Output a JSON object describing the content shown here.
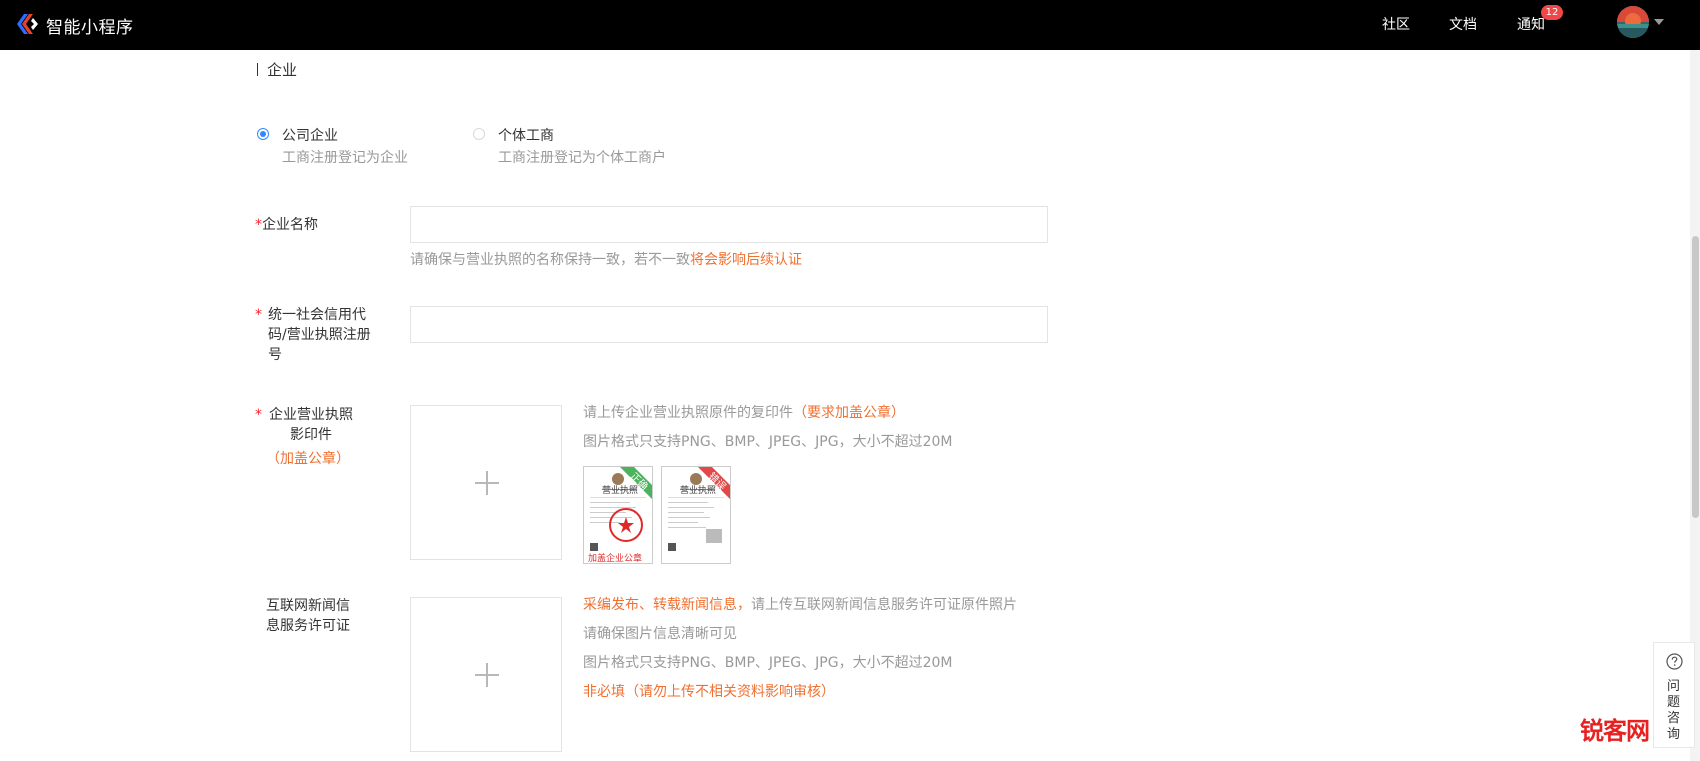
{
  "header": {
    "brand": "智能小程序",
    "nav": [
      {
        "label": "社区"
      },
      {
        "label": "文档"
      },
      {
        "label": "通知",
        "badge": "12"
      }
    ]
  },
  "section": {
    "title": "企业"
  },
  "entity_type": {
    "options": [
      {
        "title": "公司企业",
        "desc": "工商注册登记为企业",
        "selected": true
      },
      {
        "title": "个体工商",
        "desc": "工商注册登记为个体工商户",
        "selected": false
      }
    ]
  },
  "fields": {
    "company_name": {
      "required_mark": "*",
      "label": "企业名称",
      "value": "",
      "hint": "请确保与营业执照的名称保持一致，若不一致",
      "hint_warning": "将会影响后续认证"
    },
    "credit_code": {
      "required_mark": "*",
      "label_lines": [
        "统一社会信用代",
        "码/营业执照注册",
        "号"
      ],
      "value": ""
    },
    "license_copy": {
      "required_mark": "*",
      "label_lines": [
        "企业营业执照",
        "影印件"
      ],
      "label_note": "（加盖公章）",
      "hint": "请上传企业营业执照原件的复印件",
      "hint_warning": "（要求加盖公章）",
      "format_hint": "图片格式只支持PNG、BMP、JPEG、JPG，大小不超过20M",
      "samples": [
        {
          "tag": "正确",
          "title": "营业执照",
          "stamp_text": "加盖企业公章"
        },
        {
          "tag": "错误",
          "title": "营业执照"
        }
      ]
    },
    "news_license": {
      "label_lines": [
        "互联网新闻信",
        "息服务许可证"
      ],
      "hint_warning": "采编发布、转载新闻信息，",
      "hint": "请上传互联网新闻信息服务许可证原件照片",
      "hint2": "请确保图片信息清晰可见",
      "format_hint": "图片格式只支持PNG、BMP、JPEG、JPG，大小不超过20M",
      "optional_note": "非必填（请勿上传不相关资料影响审核）"
    }
  },
  "consult": {
    "label": "问题咨询"
  },
  "watermark": {
    "text": "锐客网"
  },
  "colors": {
    "accent_blue": "#3388ff",
    "warning_orange": "#f07030",
    "required_red": "#f5222d",
    "topbar": "#000000",
    "sample_ok": "#4cb25c",
    "sample_bad": "#e24848"
  }
}
